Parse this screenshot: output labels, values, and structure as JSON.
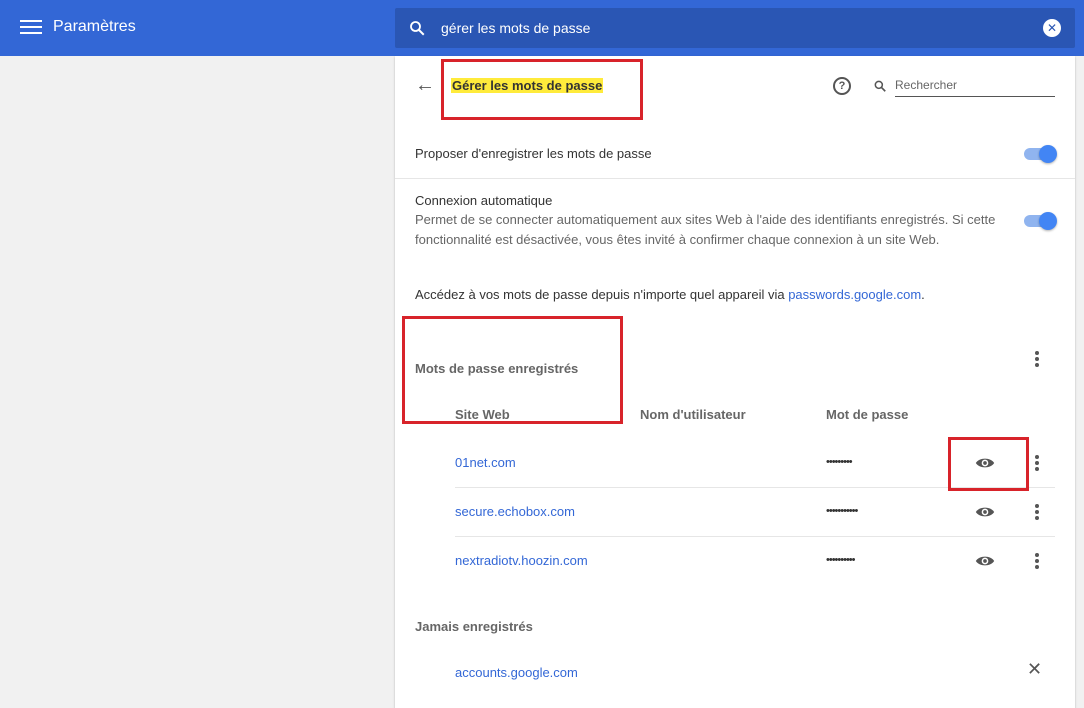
{
  "header": {
    "menu_icon": "hamburger-menu-icon",
    "app_title": "Paramètres",
    "search_value": "gérer les mots de passe",
    "clear_icon": "clear-icon"
  },
  "page": {
    "title": "Gérer les mots de passe",
    "search_placeholder": "Rechercher",
    "offer_save_label": "Proposer d'enregistrer les mots de passe",
    "offer_save_enabled": true,
    "autologin_label": "Connexion automatique",
    "autologin_description": "Permet de se connecter automatiquement aux sites Web à l'aide des identifiants enregistrés. Si cette fonctionnalité est désactivée, vous êtes invité à confirmer chaque connexion à un site Web.",
    "autologin_enabled": true,
    "info_text": "Accédez à vos mots de passe depuis n'importe quel appareil via ",
    "info_link": "passwords.google.com",
    "info_suffix": "."
  },
  "saved_passwords": {
    "section_title": "Mots de passe enregistrés",
    "columns": [
      "Site Web",
      "Nom d'utilisateur",
      "Mot de passe"
    ],
    "rows": [
      {
        "site": "01net.com",
        "username": "",
        "password": "•••••••••"
      },
      {
        "site": "secure.echobox.com",
        "username": "",
        "password": "•••••••••••"
      },
      {
        "site": "nextradiotv.hoozin.com",
        "username": "",
        "password": "••••••••••"
      }
    ]
  },
  "never_saved": {
    "section_title": "Jamais enregistrés",
    "rows": [
      {
        "site": "accounts.google.com"
      }
    ]
  },
  "colors": {
    "topbar": "#3367d6",
    "link": "#3367d6",
    "toggle_on": "#4285f4",
    "highlight": "#ffeb3b",
    "annotation": "#d8232a"
  }
}
